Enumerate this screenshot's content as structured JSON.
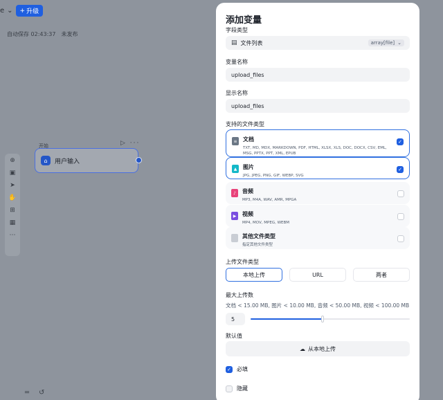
{
  "canvas": {
    "top_left_text": "e",
    "upgrade_label": "升级",
    "autosave_label": "自动保存 02:43:37",
    "publish_status": "未发布",
    "node_group_label": "开始",
    "node_title": "用户输入",
    "node_actions": "▷ ···"
  },
  "panel": {
    "title": "添加变量",
    "field_type": {
      "label": "字段类型",
      "value": "文件列表",
      "tag": "array[file]"
    },
    "var_name": {
      "label": "变量名称",
      "value": "upload_files"
    },
    "display_name": {
      "label": "显示名称",
      "value": "upload_files"
    },
    "file_types": {
      "label": "支持的文件类型",
      "items": [
        {
          "name": "文档",
          "desc": "TXT, MD, MDX, MARKDOWN, PDF, HTML, XLSX, XLS, DOC, DOCX, CSV, EML, MSG, PPTX, PPT, XML, EPUB",
          "checked": true,
          "color": "#6b7785"
        },
        {
          "name": "图片",
          "desc": "JPG, JPEG, PNG, GIF, WEBP, SVG",
          "checked": true,
          "color": "#14b8c8"
        },
        {
          "name": "音频",
          "desc": "MP3, M4A, WAV, AMR, MPGA",
          "checked": false,
          "color": "#e8437a"
        },
        {
          "name": "视频",
          "desc": "MP4, MOV, MPEG, WEBM",
          "checked": false,
          "color": "#7a4ee0"
        },
        {
          "name": "其他文件类型",
          "desc": "指定其他文件类型",
          "checked": false,
          "color": "#c9cdd4"
        }
      ]
    },
    "upload_type": {
      "label": "上传文件类型",
      "options": [
        "本地上传",
        "URL",
        "两者"
      ],
      "selected": "本地上传"
    },
    "max_upload": {
      "label": "最大上传数",
      "hint": "文档 < 15.00 MB, 图片 < 10.00 MB, 音频 < 50.00 MB, 视频 < 100.00 MB",
      "value": "5",
      "slider_fraction": 0.45
    },
    "default_value": {
      "label": "默认值",
      "button_label": "从本地上传"
    },
    "required": {
      "label": "必填",
      "checked": true
    },
    "hidden": {
      "label": "隐藏",
      "checked": false
    }
  }
}
